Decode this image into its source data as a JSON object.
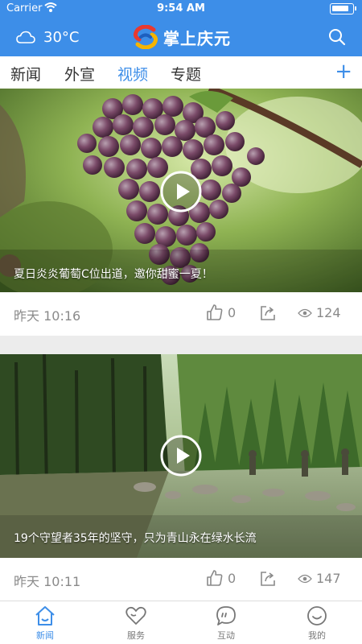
{
  "status": {
    "carrier": "Carrier",
    "time": "9:54 AM"
  },
  "header": {
    "temperature": "30°C",
    "brand": "掌上庆元"
  },
  "tabs": [
    {
      "label": "新闻",
      "active": false
    },
    {
      "label": "外宣",
      "active": false
    },
    {
      "label": "视频",
      "active": true
    },
    {
      "label": "专题",
      "active": false
    }
  ],
  "videos": [
    {
      "caption": "夏日炎炎葡萄C位出道，邀你甜蜜一夏！",
      "time": "昨天 10:16",
      "likes": "0",
      "views": "124"
    },
    {
      "caption": "19个守望者35年的坚守，只为青山永在绿水长流",
      "time": "昨天 10:11",
      "likes": "0",
      "views": "147"
    }
  ],
  "tabbar": [
    {
      "label": "新闻",
      "icon": "home-icon",
      "active": true
    },
    {
      "label": "服务",
      "icon": "heart-icon",
      "active": false
    },
    {
      "label": "互动",
      "icon": "chat-icon",
      "active": false
    },
    {
      "label": "我的",
      "icon": "smile-icon",
      "active": false
    }
  ],
  "colors": {
    "accent": "#3d8ee8"
  }
}
